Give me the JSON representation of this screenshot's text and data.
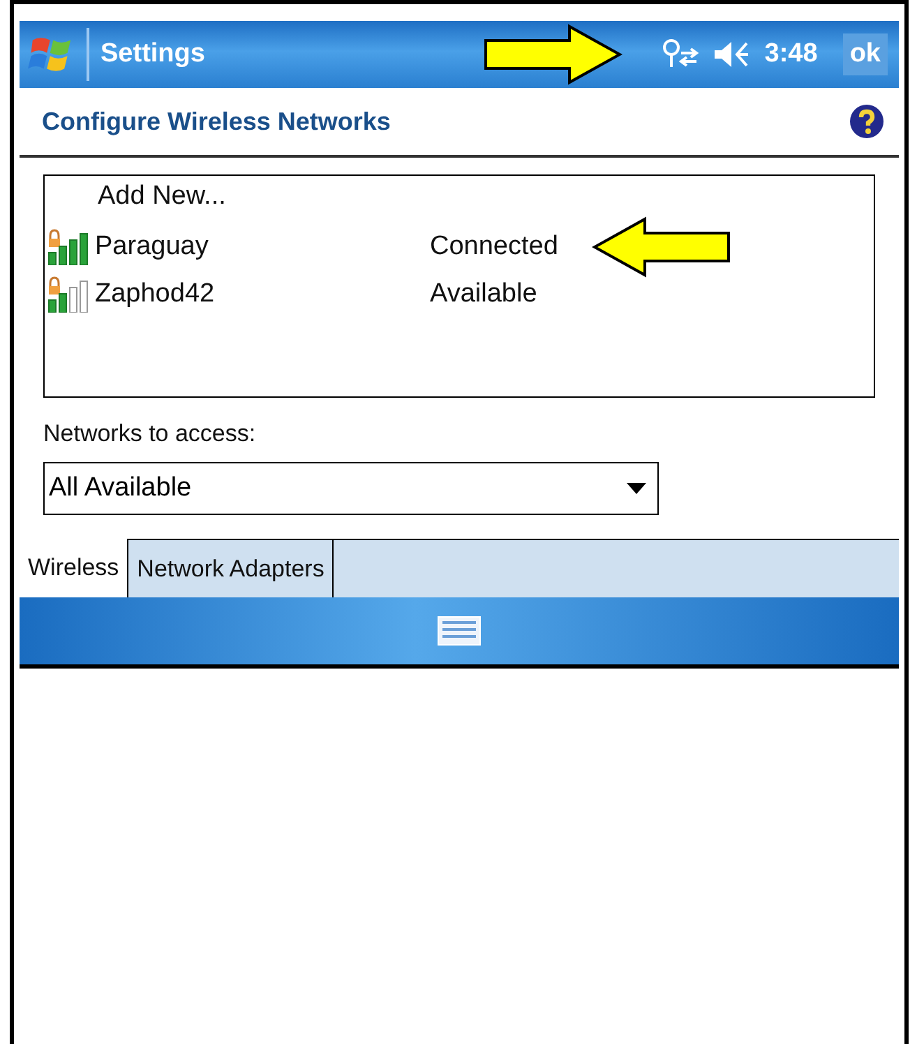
{
  "title_bar": {
    "title": "Settings",
    "time": "3:48",
    "ok": "ok"
  },
  "header": {
    "title": "Configure Wireless Networks"
  },
  "networks": {
    "add_new": "Add New...",
    "items": [
      {
        "name": "Paraguay",
        "status": "Connected",
        "kind": "strong",
        "secured": true
      },
      {
        "name": "Zaphod42",
        "status": "Available",
        "kind": "weak",
        "secured": true
      }
    ]
  },
  "access": {
    "label": "Networks to access:",
    "value": "All Available"
  },
  "tabs": [
    {
      "label": "Wireless",
      "selected": true
    },
    {
      "label": "Network Adapters",
      "selected": false
    }
  ]
}
